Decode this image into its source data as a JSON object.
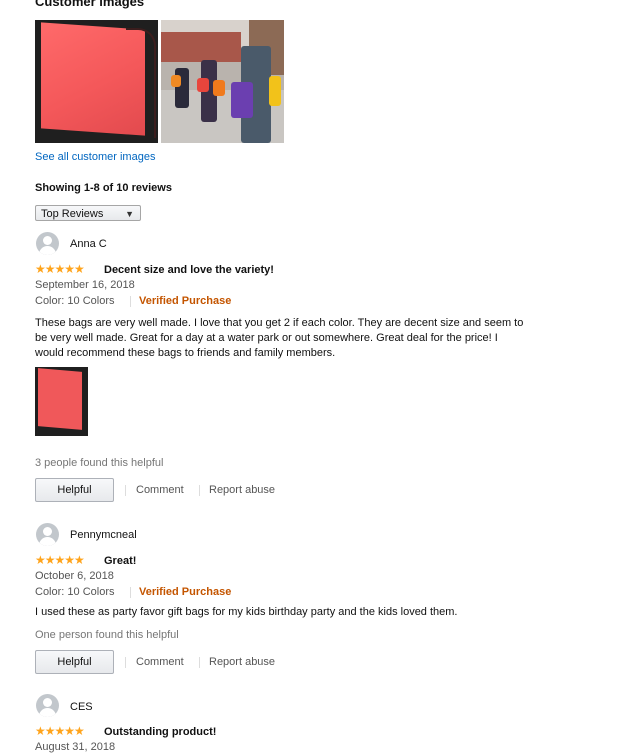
{
  "customer_images": {
    "title": "Customer images",
    "see_all": "See all customer images"
  },
  "reviews_header": {
    "showing": "Showing 1-8 of 10 reviews",
    "sort_selected": "Top Reviews"
  },
  "reviews": [
    {
      "author": "Anna C",
      "stars": "★★★★★",
      "title": "Decent size and love the variety!",
      "date": "September 16, 2018",
      "color": "Color: 10 Colors",
      "verified": "Verified Purchase",
      "body_lines": [
        "These bags are very well made. I love that you get 2 if each color. They are decent size and seem to",
        "be very well made. Great for a day at a water park or out somewhere. Great deal for the price! I",
        "would recommend these bags to friends and family members."
      ],
      "helpful_count": "3 people found this helpful",
      "helpful_label": "Helpful",
      "comment_label": "Comment",
      "report_label": "Report abuse"
    },
    {
      "author": "Pennymcneal",
      "stars": "★★★★★",
      "title": "Great!",
      "date": "October 6, 2018",
      "color": "Color: 10 Colors",
      "verified": "Verified Purchase",
      "body_lines": [
        "I used these as party favor gift bags for my kids birthday party and the kids loved them."
      ],
      "helpful_count": "One person found this helpful",
      "helpful_label": "Helpful",
      "comment_label": "Comment",
      "report_label": "Report abuse"
    },
    {
      "author": "CES",
      "stars": "★★★★★",
      "title": "Outstanding product!",
      "date": "August 31, 2018"
    }
  ],
  "colors": {
    "star": "#ffa41c",
    "verified": "#c45500",
    "link": "#0066c0"
  }
}
